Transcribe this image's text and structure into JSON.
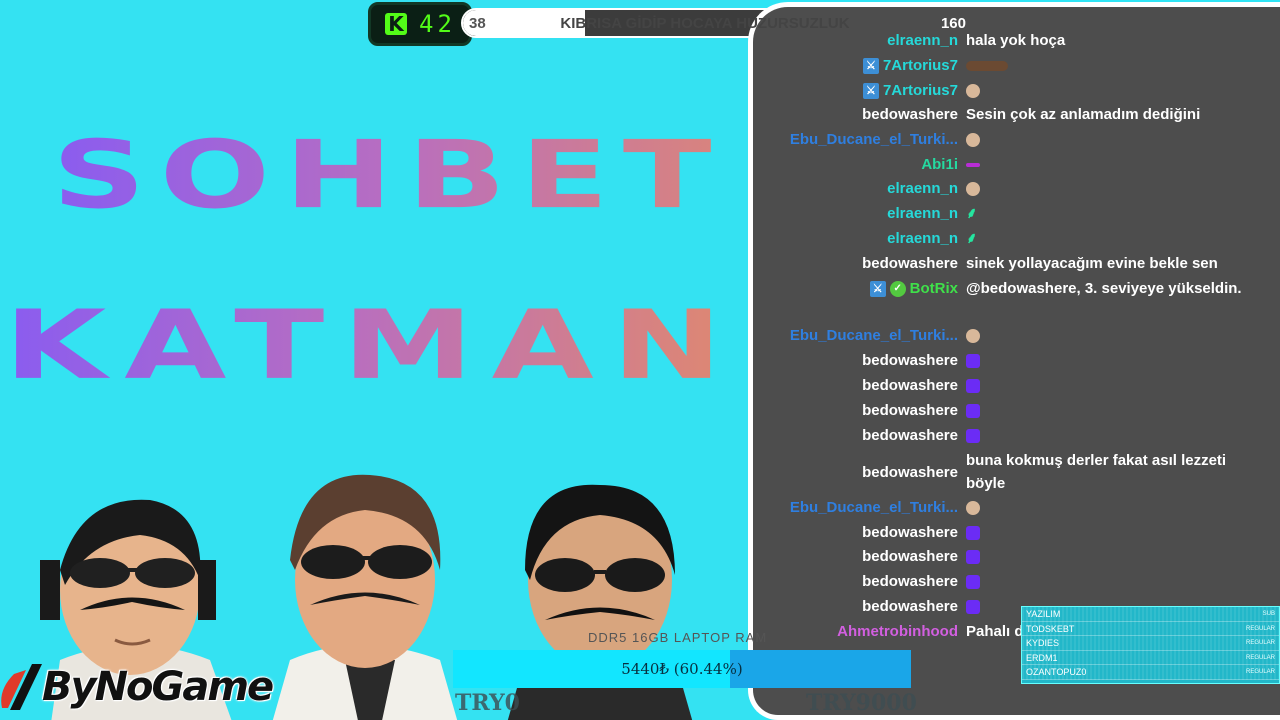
{
  "title": {
    "line1": "SOHBET",
    "line2": "KATMANI"
  },
  "counter": {
    "icon": "kick-icon",
    "icon_glyph": "K",
    "value": "42"
  },
  "goal": {
    "min": "38",
    "title": "KIBRISA GİDİP HOCAYA HUZURSUZLUK",
    "max": "160",
    "progress_fraction": 0.237
  },
  "chat": [
    {
      "user": "elraenn_n",
      "color": "#25d9d9",
      "text": "hala yok hoça"
    },
    {
      "user": "7Artorius7",
      "color": "#25d9d9",
      "badges": [
        "sword-badge"
      ],
      "emote": "brown"
    },
    {
      "user": "7Artorius7",
      "color": "#25d9d9",
      "badges": [
        "sword-badge"
      ],
      "emote": "face"
    },
    {
      "user": "bedowashere",
      "color": "#ffffff",
      "text": "Sesin çok az anlamadım dediğini"
    },
    {
      "user": "Ebu_Ducane_el_Turki...",
      "color": "#2f7fe0",
      "emote": "face"
    },
    {
      "user": "Abi1i",
      "color": "#25d9a0",
      "emote": "bar"
    },
    {
      "user": "elraenn_n",
      "color": "#25d9d9",
      "emote": "face"
    },
    {
      "user": "elraenn_n",
      "color": "#25d9d9",
      "emote": "green"
    },
    {
      "user": "elraenn_n",
      "color": "#25d9d9",
      "emote": "green"
    },
    {
      "user": "bedowashere",
      "color": "#ffffff",
      "text": "sinek yollayacağım evine bekle sen"
    },
    {
      "user": "BotRix",
      "color": "#3fe04a",
      "badges": [
        "sword-badge",
        "verified-badge"
      ],
      "text": "@bedowashere, 3. seviyeye yükseldin."
    },
    {
      "user": "Ebu_Ducane_el_Turki...",
      "color": "#2f7fe0",
      "emote": "face"
    },
    {
      "user": "bedowashere",
      "color": "#ffffff",
      "emote": "purple"
    },
    {
      "user": "bedowashere",
      "color": "#ffffff",
      "emote": "purple"
    },
    {
      "user": "bedowashere",
      "color": "#ffffff",
      "emote": "purple"
    },
    {
      "user": "bedowashere",
      "color": "#ffffff",
      "emote": "purple"
    },
    {
      "user": "bedowashere",
      "color": "#ffffff",
      "text": "buna kokmuş derler fakat asıl lezzeti böyle"
    },
    {
      "user": "Ebu_Ducane_el_Turki...",
      "color": "#2f7fe0",
      "emote": "face"
    },
    {
      "user": "bedowashere",
      "color": "#ffffff",
      "emote": "purple"
    },
    {
      "user": "bedowashere",
      "color": "#ffffff",
      "emote": "purple"
    },
    {
      "user": "bedowashere",
      "color": "#ffffff",
      "emote": "purple"
    },
    {
      "user": "bedowashere",
      "color": "#ffffff",
      "emote": "purple"
    },
    {
      "user": "Ahmetrobinhood",
      "color": "#d25fe0",
      "text": "Pahalı değil"
    }
  ],
  "leaderboard": {
    "rows": [
      {
        "name": "YAZILIM",
        "right": "SUB"
      },
      {
        "name": "TODSKEBT",
        "right": "REGULAR"
      },
      {
        "name": "KYDIES",
        "right": "REGULAR"
      },
      {
        "name": "ERDM1",
        "right": "REGULAR"
      },
      {
        "name": "OZANTOPUZ0",
        "right": "REGULAR"
      }
    ]
  },
  "donation": {
    "product": "DDR5 16GB LAPTOP RAM",
    "label": "5440₺ (60.44%)",
    "fraction": 0.6044,
    "min": "TRY0",
    "max": "TRY9000"
  },
  "logo": {
    "text": "ByNoGame"
  },
  "colors": {
    "background": "#34e2f2",
    "chat_bg": "#4d4d4d",
    "kick_green": "#53fc18"
  }
}
